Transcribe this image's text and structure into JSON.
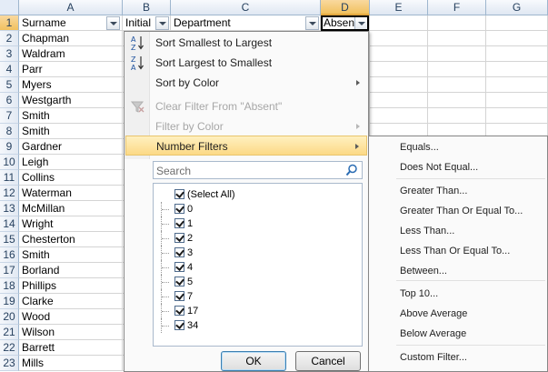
{
  "columns": [
    "A",
    "B",
    "C",
    "D",
    "E",
    "F",
    "G"
  ],
  "header_row": {
    "surname": "Surname",
    "initial": "Initial",
    "department": "Department",
    "absent": "Absen"
  },
  "rows": [
    {
      "n": "1"
    },
    {
      "n": "2",
      "a": "Chapman"
    },
    {
      "n": "3",
      "a": "Waldram"
    },
    {
      "n": "4",
      "a": "Parr"
    },
    {
      "n": "5",
      "a": "Myers"
    },
    {
      "n": "6",
      "a": "Westgarth"
    },
    {
      "n": "7",
      "a": "Smith"
    },
    {
      "n": "8",
      "a": "Smith"
    },
    {
      "n": "9",
      "a": "Gardner"
    },
    {
      "n": "10",
      "a": "Leigh"
    },
    {
      "n": "11",
      "a": "Collins"
    },
    {
      "n": "12",
      "a": "Waterman"
    },
    {
      "n": "13",
      "a": "McMillan"
    },
    {
      "n": "14",
      "a": "Wright"
    },
    {
      "n": "15",
      "a": "Chesterton"
    },
    {
      "n": "16",
      "a": "Smith"
    },
    {
      "n": "17",
      "a": "Borland"
    },
    {
      "n": "18",
      "a": "Phillips"
    },
    {
      "n": "19",
      "a": "Clarke"
    },
    {
      "n": "20",
      "a": "Wood"
    },
    {
      "n": "21",
      "a": "Wilson"
    },
    {
      "n": "22",
      "a": "Barrett"
    },
    {
      "n": "23",
      "a": "Mills"
    }
  ],
  "filter_menu": {
    "sort_asc": "Sort Smallest to Largest",
    "sort_desc": "Sort Largest to Smallest",
    "sort_color": "Sort by Color",
    "clear_filter": "Clear Filter From \"Absent\"",
    "filter_color": "Filter by Color",
    "number_filters": "Number Filters",
    "search_placeholder": "Search",
    "values": [
      "(Select All)",
      "0",
      "1",
      "2",
      "3",
      "4",
      "5",
      "7",
      "17",
      "34"
    ],
    "ok": "OK",
    "cancel": "Cancel"
  },
  "number_filters_menu": [
    "Equals...",
    "Does Not Equal...",
    "Greater Than...",
    "Greater Than Or Equal To...",
    "Less Than...",
    "Less Than Or Equal To...",
    "Between...",
    "Top 10...",
    "Above Average",
    "Below Average",
    "Custom Filter..."
  ],
  "colors": {
    "header_bg": "#dfe7f2",
    "active_header": "#f1c15f",
    "highlight": "#fcd986"
  },
  "icons": {
    "sort_asc": "sort-az-icon",
    "sort_desc": "sort-za-icon",
    "clear": "funnel-clear-icon",
    "search": "magnifier-icon"
  }
}
